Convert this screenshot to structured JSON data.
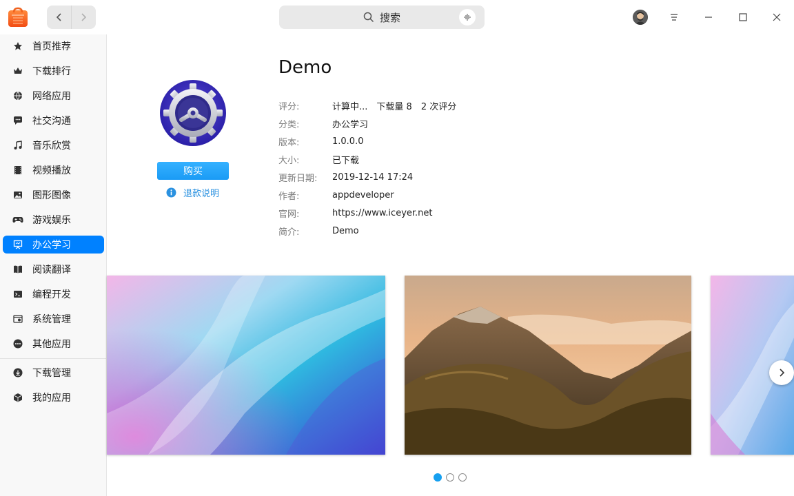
{
  "search": {
    "placeholder": "搜索"
  },
  "sidebar": {
    "items": [
      {
        "label": "首页推荐",
        "icon": "star-icon"
      },
      {
        "label": "下载排行",
        "icon": "crown-icon"
      },
      {
        "label": "网络应用",
        "icon": "globe-icon"
      },
      {
        "label": "社交沟通",
        "icon": "chat-icon"
      },
      {
        "label": "音乐欣赏",
        "icon": "music-icon"
      },
      {
        "label": "视频播放",
        "icon": "film-icon"
      },
      {
        "label": "图形图像",
        "icon": "image-icon"
      },
      {
        "label": "游戏娱乐",
        "icon": "gamepad-icon"
      },
      {
        "label": "办公学习",
        "icon": "presentation-icon",
        "active": true
      },
      {
        "label": "阅读翻译",
        "icon": "book-icon"
      },
      {
        "label": "编程开发",
        "icon": "terminal-icon"
      },
      {
        "label": "系统管理",
        "icon": "system-icon"
      },
      {
        "label": "其他应用",
        "icon": "more-icon"
      }
    ],
    "bottom_items": [
      {
        "label": "下载管理",
        "icon": "download-icon"
      },
      {
        "label": "我的应用",
        "icon": "box-icon"
      }
    ]
  },
  "app": {
    "name": "Demo",
    "buy_label": "购买",
    "refund_label": "退款说明",
    "info": {
      "rating_key": "评分:",
      "rating_status": "计算中...",
      "downloads": "下载量 8",
      "reviews": "2 次评分",
      "category_key": "分类:",
      "category": "办公学习",
      "version_key": "版本:",
      "version": "1.0.0.0",
      "size_key": "大小:",
      "size": "已下载",
      "updated_key": "更新日期:",
      "updated": "2019-12-14 17:24",
      "author_key": "作者:",
      "author": "appdeveloper",
      "website_key": "官网:",
      "website": "https://www.iceyer.net",
      "intro_key": "简介:",
      "intro": "Demo"
    }
  },
  "carousel": {
    "page_count": 3,
    "active_index": 0
  },
  "colors": {
    "accent": "#0081ff",
    "buy_button": "#2aa6ff",
    "link": "#2a91e0"
  }
}
